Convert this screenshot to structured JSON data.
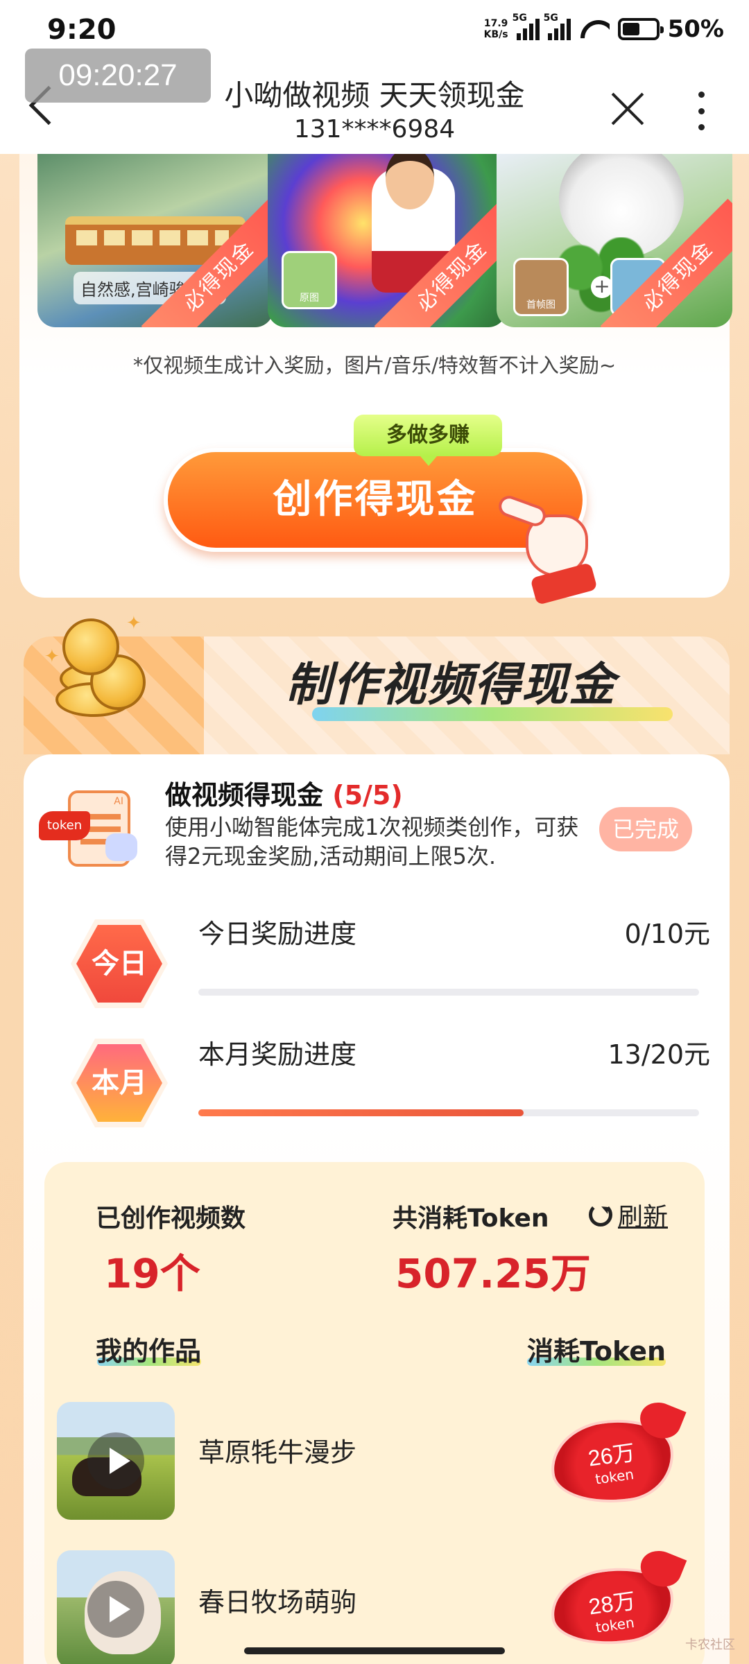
{
  "status_bar": {
    "time": "9:20",
    "net_speed": "17.9",
    "net_unit": "KB/s",
    "sig1": "5G",
    "sig2": "5G",
    "battery": "50%"
  },
  "nav": {
    "overlay_time": "09:20:27",
    "title": "小呦做视频 天天领现金",
    "subtitle": "131****6984"
  },
  "examples": {
    "items": [
      {
        "caption": "自然感,宫崎骏风格",
        "badge": "必得现金"
      },
      {
        "caption": "原图",
        "badge": "必得现金"
      },
      {
        "caption": "首帧图",
        "caption2": "尾帧",
        "badge": "必得现金"
      }
    ],
    "note": "*仅视频生成计入奖励，图片/音乐/特效暂不计入奖励~"
  },
  "cta": {
    "tag": "多做多赚",
    "label": "创作得现金"
  },
  "section": {
    "title": "制作视频得现金"
  },
  "task": {
    "title": "做视频得现金",
    "count": "(5/5)",
    "desc": "使用小呦智能体完成1次视频类创作，可获得2元现金奖励,活动期间上限5次.",
    "status": "已完成",
    "icon_token_label": "token",
    "icon_ai_label": "AI"
  },
  "progress": [
    {
      "badge": "今日",
      "label": "今日奖励进度",
      "value": "0/10元",
      "ratio": 0.0
    },
    {
      "badge": "本月",
      "label": "本月奖励进度",
      "value": "13/20元",
      "ratio": 0.65
    }
  ],
  "stats": {
    "videos_label": "已创作视频数",
    "videos_value": "19个",
    "token_label": "共消耗Token",
    "token_value": "507.25万",
    "refresh_label": "刷新"
  },
  "works": {
    "header_left": "我的作品",
    "header_right": "消耗Token",
    "items": [
      {
        "title": "草原牦牛漫步",
        "tokens": "26万",
        "unit": "token"
      },
      {
        "title": "春日牧场萌驹",
        "tokens": "28万",
        "unit": "token"
      }
    ]
  },
  "footer": {
    "watermark": "卡农社区"
  },
  "colors": {
    "accent": "#ff5a12",
    "primary_red": "#d8232a",
    "progress_fill": "#e9553a"
  }
}
